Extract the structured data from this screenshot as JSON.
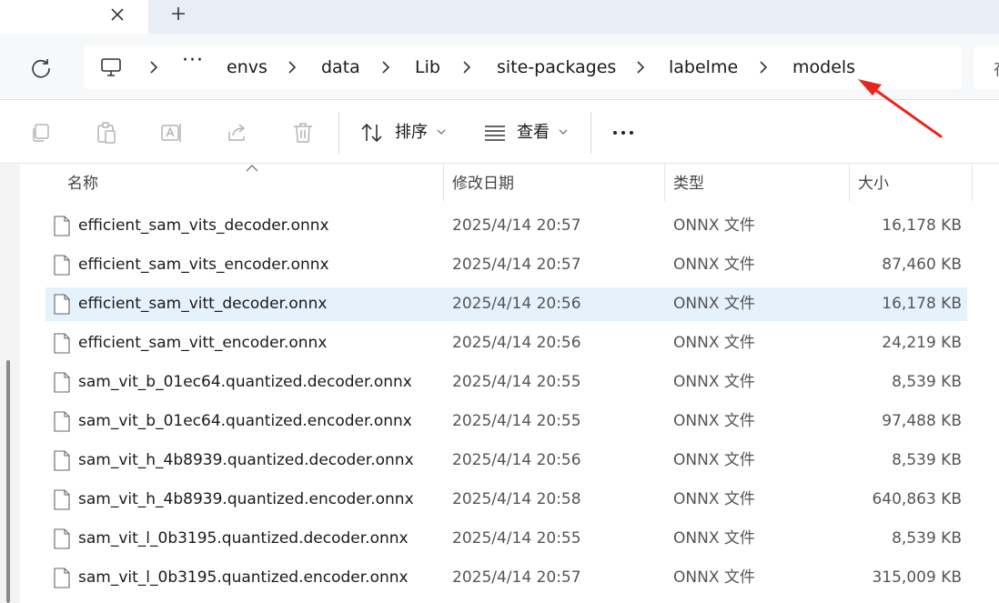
{
  "tab": {
    "close_glyph": "✕",
    "new_glyph": "+"
  },
  "breadcrumb": {
    "more": "···",
    "items": [
      "envs",
      "data",
      "Lib",
      "site-packages",
      "labelme",
      "models"
    ]
  },
  "search": {
    "partial_text": "在"
  },
  "toolbar": {
    "sort_label": "排序",
    "view_label": "查看",
    "more_glyph": "···"
  },
  "columns": {
    "name": "名称",
    "date": "修改日期",
    "type": "类型",
    "size": "大小"
  },
  "files": [
    {
      "name": "efficient_sam_vits_decoder.onnx",
      "date": "2025/4/14 20:57",
      "type": "ONNX 文件",
      "size": "16,178 KB",
      "selected": false
    },
    {
      "name": "efficient_sam_vits_encoder.onnx",
      "date": "2025/4/14 20:57",
      "type": "ONNX 文件",
      "size": "87,460 KB",
      "selected": false
    },
    {
      "name": "efficient_sam_vitt_decoder.onnx",
      "date": "2025/4/14 20:56",
      "type": "ONNX 文件",
      "size": "16,178 KB",
      "selected": true
    },
    {
      "name": "efficient_sam_vitt_encoder.onnx",
      "date": "2025/4/14 20:56",
      "type": "ONNX 文件",
      "size": "24,219 KB",
      "selected": false
    },
    {
      "name": "sam_vit_b_01ec64.quantized.decoder.onnx",
      "date": "2025/4/14 20:55",
      "type": "ONNX 文件",
      "size": "8,539 KB",
      "selected": false
    },
    {
      "name": "sam_vit_b_01ec64.quantized.encoder.onnx",
      "date": "2025/4/14 20:55",
      "type": "ONNX 文件",
      "size": "97,488 KB",
      "selected": false
    },
    {
      "name": "sam_vit_h_4b8939.quantized.decoder.onnx",
      "date": "2025/4/14 20:56",
      "type": "ONNX 文件",
      "size": "8,539 KB",
      "selected": false
    },
    {
      "name": "sam_vit_h_4b8939.quantized.encoder.onnx",
      "date": "2025/4/14 20:58",
      "type": "ONNX 文件",
      "size": "640,863 KB",
      "selected": false
    },
    {
      "name": "sam_vit_l_0b3195.quantized.decoder.onnx",
      "date": "2025/4/14 20:55",
      "type": "ONNX 文件",
      "size": "8,539 KB",
      "selected": false
    },
    {
      "name": "sam_vit_l_0b3195.quantized.encoder.onnx",
      "date": "2025/4/14 20:57",
      "type": "ONNX 文件",
      "size": "315,009 KB",
      "selected": false
    }
  ],
  "colors": {
    "selection": "#e5f1fb",
    "annotation_arrow": "#e8261f",
    "tabstrip": "#e9eef6"
  },
  "icons": {
    "toolbar": [
      "copy-icon",
      "paste-icon",
      "rename-icon",
      "share-icon",
      "delete-icon",
      "sort-icon",
      "view-icon",
      "more-icon"
    ],
    "file": "document-icon"
  }
}
